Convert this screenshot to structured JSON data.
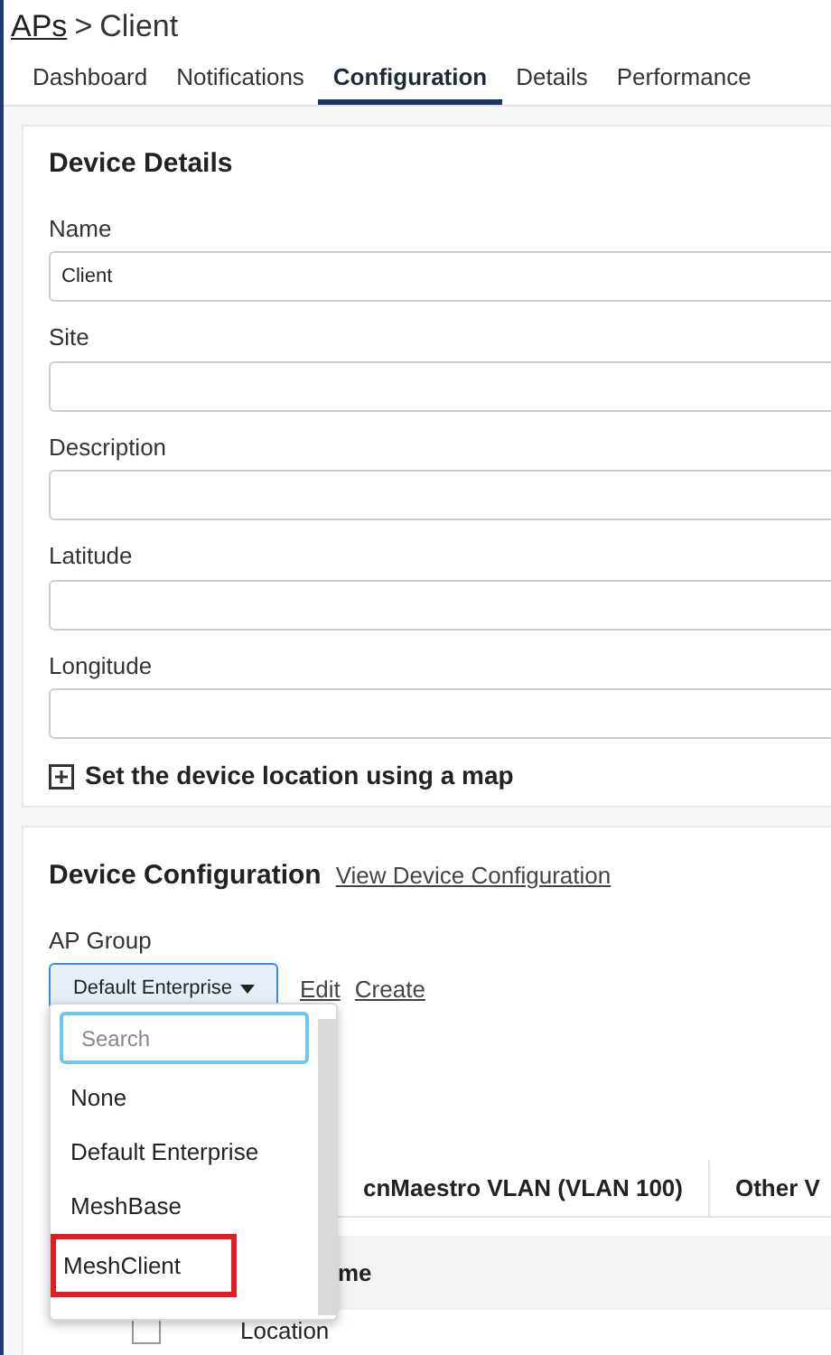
{
  "breadcrumb": {
    "parent": "APs",
    "separator": ">",
    "current": "Client"
  },
  "tabs": [
    {
      "label": "Dashboard",
      "selected": false
    },
    {
      "label": "Notifications",
      "selected": false
    },
    {
      "label": "Configuration",
      "selected": true
    },
    {
      "label": "Details",
      "selected": false
    },
    {
      "label": "Performance",
      "selected": false
    }
  ],
  "device_details": {
    "title": "Device Details",
    "fields": [
      {
        "label": "Name",
        "value": "Client"
      },
      {
        "label": "Site"
      },
      {
        "label": "Description"
      },
      {
        "label": "Latitude"
      },
      {
        "label": "Longitude"
      }
    ],
    "map_toggle": "Set the device location using a map"
  },
  "device_configuration": {
    "title": "Device Configuration",
    "link": "View Device Configuration",
    "ap_group": {
      "label": "AP Group",
      "value": "Default Enterprise",
      "expanded": true,
      "links": [
        "Edit",
        "Create"
      ],
      "menu": {
        "placeholder": "Search",
        "options": [
          {
            "label": "None",
            "highlighted": false
          },
          {
            "label": "Default Enterprise",
            "highlighted": false
          },
          {
            "label": "MeshBase",
            "highlighted": false
          },
          {
            "label": "MeshClient",
            "highlighted": true
          }
        ]
      }
    },
    "table": {
      "tabs": [
        "cnMaestro VLAN (VLAN 100)",
        "Other V"
      ],
      "header": "me",
      "rows": [
        {
          "checked": false,
          "name": "Location"
        }
      ]
    }
  }
}
